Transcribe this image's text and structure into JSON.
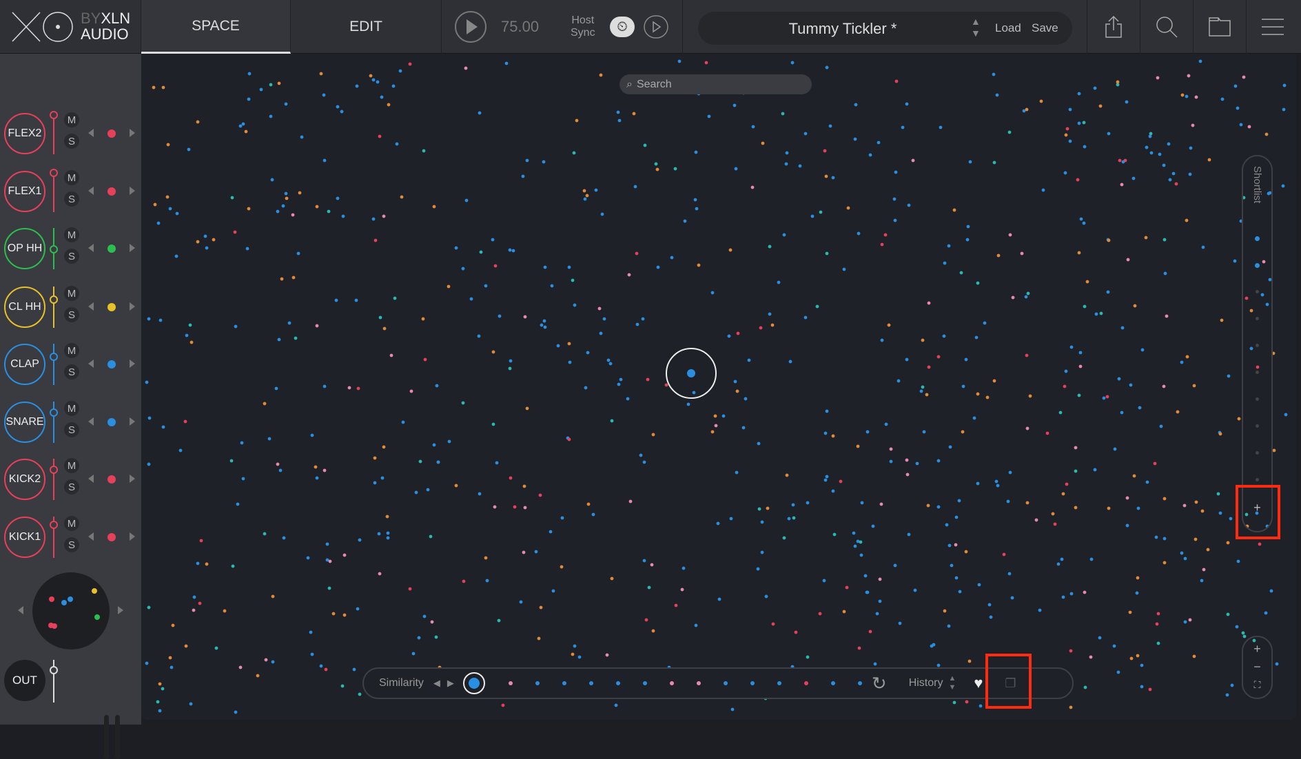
{
  "header": {
    "logo": {
      "by": "BY",
      "brand": "XLN",
      "sub": "AUDIO"
    },
    "tabs": [
      {
        "label": "SPACE",
        "active": true
      },
      {
        "label": "EDIT",
        "active": false
      }
    ],
    "tempo": "75.00",
    "host_sync": [
      "Host",
      "Sync"
    ],
    "preset_name": "Tummy Tickler *",
    "load": "Load",
    "save": "Save",
    "icons": [
      "share-icon",
      "search-icon",
      "folder-icon",
      "menu-icon"
    ]
  },
  "tracks": [
    {
      "name": "FLEX2",
      "color": "#e8405a",
      "level": 0.95,
      "m": "M",
      "s": "S"
    },
    {
      "name": "FLEX1",
      "color": "#e8405a",
      "level": 0.95,
      "m": "M",
      "s": "S"
    },
    {
      "name": "OP HH",
      "color": "#2bbf4e",
      "level": 0.42,
      "m": "M",
      "s": "S"
    },
    {
      "name": "CL HH",
      "color": "#e8c12a",
      "level": 0.65,
      "m": "M",
      "s": "S"
    },
    {
      "name": "CLAP",
      "color": "#2a8fe0",
      "level": 0.65,
      "m": "M",
      "s": "S"
    },
    {
      "name": "SNARE",
      "color": "#2a8fe0",
      "level": 0.7,
      "m": "M",
      "s": "S"
    },
    {
      "name": "KICK2",
      "color": "#e8405a",
      "level": 0.7,
      "m": "M",
      "s": "S"
    },
    {
      "name": "KICK1",
      "color": "#e8405a",
      "level": 0.78,
      "m": "M",
      "s": "S"
    }
  ],
  "output": {
    "label": "OUT",
    "level": 0.75
  },
  "search": {
    "placeholder": "Search"
  },
  "bottom_bar": {
    "similarity": "Similarity",
    "history": "History",
    "sequence": [
      "#e88ab0",
      "#2a8fe0",
      "#2a8fe0",
      "#2a8fe0",
      "#2a8fe0",
      "#2a8fe0",
      "#e88ab0",
      "#e88ab0",
      "#2a8fe0",
      "#2a8fe0",
      "#2a8fe0",
      "#e8405a",
      "#2a8fe0",
      "#2a8fe0"
    ]
  },
  "shortlist": {
    "label": "Shortlist",
    "filled": 2,
    "slots": 10,
    "add": "+"
  },
  "zoom": {
    "in": "+",
    "out": "−"
  },
  "colors": {
    "accent": "#2a8fe0",
    "highlight": "#ff2a10"
  }
}
